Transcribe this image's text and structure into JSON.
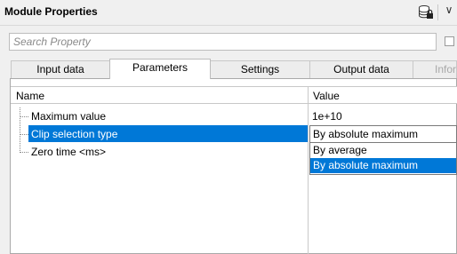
{
  "header": {
    "title": "Module Properties",
    "icon": "database-lock-icon",
    "chevron": "∨"
  },
  "search": {
    "placeholder": "Search Property",
    "value": ""
  },
  "tabs": [
    {
      "label": "Input data",
      "active": false
    },
    {
      "label": "Parameters",
      "active": true
    },
    {
      "label": "Settings",
      "active": false
    },
    {
      "label": "Output data",
      "active": false
    },
    {
      "label": "Infor",
      "active": false,
      "disabled": true
    }
  ],
  "grid": {
    "columns": {
      "name": "Name",
      "value": "Value"
    },
    "rows": [
      {
        "name": "Maximum value",
        "value": "1e+10",
        "selected": false
      },
      {
        "name": "Clip selection type",
        "value": "By absolute maximum",
        "selected": true
      },
      {
        "name": "Zero time <ms>",
        "value": "",
        "selected": false
      }
    ]
  },
  "dropdown": {
    "options": [
      "By average",
      "By absolute maximum"
    ],
    "highlighted": "By absolute maximum"
  },
  "colors": {
    "selection": "#0078d7",
    "background": "#f0f0f0"
  }
}
